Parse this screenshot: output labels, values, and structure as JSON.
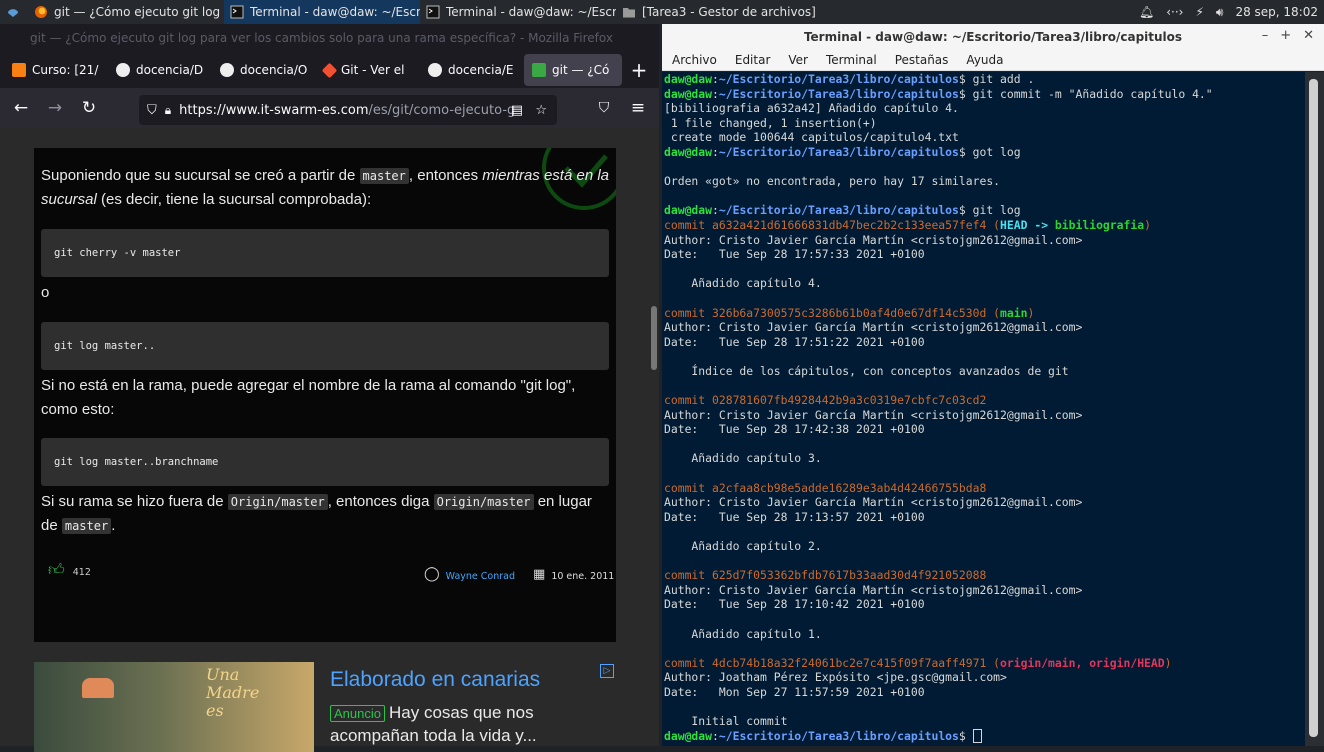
{
  "panel": {
    "tasks": [
      {
        "label": "git — ¿Cómo ejecuto git log ...",
        "icon": "firefox-icon"
      },
      {
        "label": "Terminal - daw@daw: ~/Escr...",
        "icon": "terminal-icon"
      },
      {
        "label": "Terminal - daw@daw: ~/Escr...",
        "icon": "terminal-icon"
      },
      {
        "label": "[Tarea3 - Gestor de archivos]",
        "icon": "folder-icon"
      }
    ],
    "clock": "28 sep, 18:02"
  },
  "firefox": {
    "title": "git — ¿Cómo ejecuto git log para ver los cambios solo para una rama específica? - Mozilla Firefox",
    "tabs": [
      {
        "label": "Curso: [21/"
      },
      {
        "label": "docencia/D"
      },
      {
        "label": "docencia/O"
      },
      {
        "label": "Git - Ver el"
      },
      {
        "label": "docencia/E"
      },
      {
        "label": "git — ¿Có"
      }
    ],
    "url_host": "https://www.it-swarm-es.com",
    "url_path": "/es/git/como-ejecuto-g",
    "article": {
      "p1a": "Suponiendo que su sucursal se creó a partir de ",
      "p1code": "master",
      "p1b": ", entonces ",
      "p1em": "mientras está en la sucursal",
      "p1c": " (es decir, tiene la sucursal comprobada):",
      "code1": "git cherry -v master",
      "or": "o",
      "code2": "git log master..",
      "p2": "Si no está en la rama, puede agregar el nombre de la rama al comando \"git log\", como esto:",
      "code3": "git log master..branchname",
      "p3a": "Si su rama se hizo fuera de ",
      "p3code1": "Origin/master",
      "p3b": ", entonces diga ",
      "p3code2": "Origin/master",
      "p3c": " en lugar de ",
      "p3code3": "master",
      "p3d": ".",
      "votes": "412",
      "author": "Wayne Conrad",
      "date": "10 ene. 2011"
    },
    "ad": {
      "title": "Elaborado en canarias",
      "badge": "Anuncio",
      "text": "Hay cosas que nos acompañan toda la vida y..."
    }
  },
  "terminal": {
    "title": "Terminal - daw@daw: ~/Escritorio/Tarea3/libro/capitulos",
    "menu": [
      "Archivo",
      "Editar",
      "Ver",
      "Terminal",
      "Pestañas",
      "Ayuda"
    ],
    "prompt_user": "daw@daw",
    "prompt_path": "~/Escritorio/Tarea3/libro/capitulos",
    "cmd1": "git add .",
    "cmd2": "git commit -m \"Añadido capítulo 4.\"",
    "out1": "[bibiliografia a632a42] Añadido capítulo 4.",
    "out2": " 1 file changed, 1 insertion(+)",
    "out3": " create mode 100644 capitulos/capitulo4.txt",
    "cmd3": "got log",
    "out4": "Orden «got» no encontrada, pero hay 17 similares.",
    "cmd4": "git log",
    "commits": [
      {
        "hash": "commit a632a421d61666831db47bec2b2c133eea57fef4",
        "refs": "HEAD -> bibiliografia",
        "author": "Author: Cristo Javier García Martín <cristojgm2612@gmail.com>",
        "date": "Date:   Tue Sep 28 17:57:33 2021 +0100",
        "msg": "    Añadido capítulo 4."
      },
      {
        "hash": "commit 326b6a7300575c3286b61b0af4d0e67df14c530d",
        "refs": "main",
        "author": "Author: Cristo Javier García Martín <cristojgm2612@gmail.com>",
        "date": "Date:   Tue Sep 28 17:51:22 2021 +0100",
        "msg": "    Índice de los cápitulos, con conceptos avanzados de git"
      },
      {
        "hash": "commit 028781607fb4928442b9a3c0319e7cbfc7c03cd2",
        "refs": "",
        "author": "Author: Cristo Javier García Martín <cristojgm2612@gmail.com>",
        "date": "Date:   Tue Sep 28 17:42:38 2021 +0100",
        "msg": "    Añadido capítulo 3."
      },
      {
        "hash": "commit a2cfaa8cb98e5adde16289e3ab4d42466755bda8",
        "refs": "",
        "author": "Author: Cristo Javier García Martín <cristojgm2612@gmail.com>",
        "date": "Date:   Tue Sep 28 17:13:57 2021 +0100",
        "msg": "    Añadido capítulo 2."
      },
      {
        "hash": "commit 625d7f053362bfdb7617b33aad30d4f921052088",
        "refs": "",
        "author": "Author: Cristo Javier García Martín <cristojgm2612@gmail.com>",
        "date": "Date:   Tue Sep 28 17:10:42 2021 +0100",
        "msg": "    Añadido capítulo 1."
      },
      {
        "hash": "commit 4dcb74b18a32f24061bc2e7c415f09f7aaff4971",
        "refs": "origin/main, origin/HEAD",
        "author": "Author: Joatham Pérez Expósito <jpe.gsc@gmail.com>",
        "date": "Date:   Mon Sep 27 11:57:59 2021 +0100",
        "msg": "    Initial commit"
      }
    ]
  }
}
